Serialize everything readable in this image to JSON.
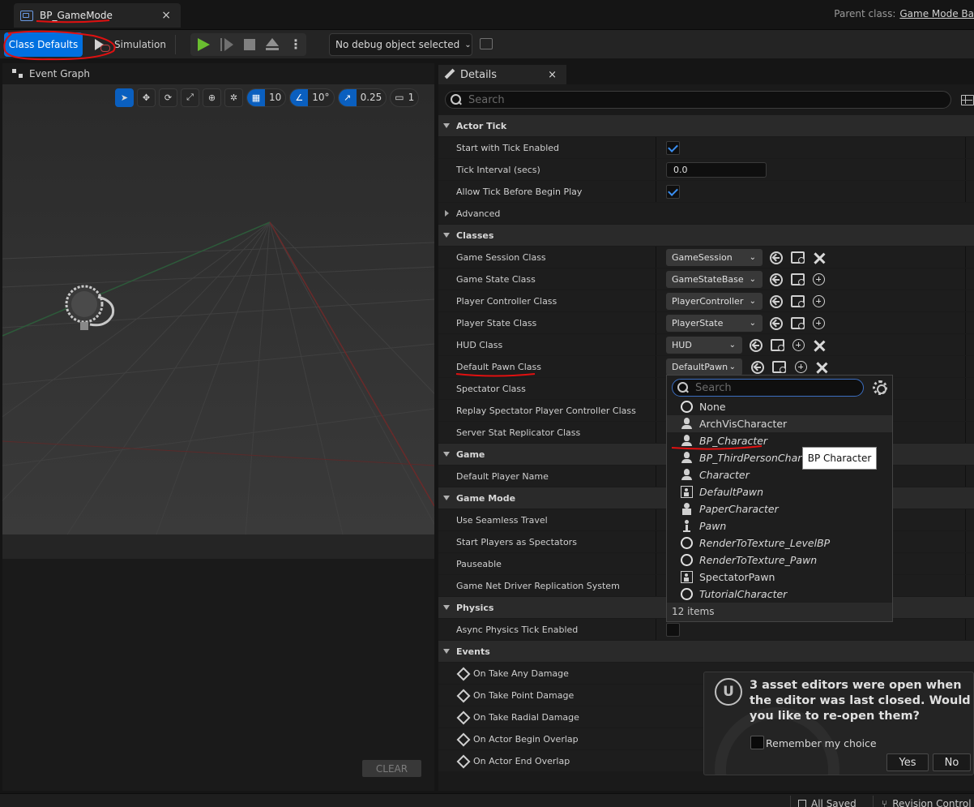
{
  "tab": {
    "title": "BP_GameMode",
    "close": "×"
  },
  "parent_class": {
    "label": "Parent class:",
    "value": "Game Mode Ba"
  },
  "toolbar": {
    "class_defaults": "Class Defaults",
    "simulation": "Simulation",
    "debug_select": "No debug object selected"
  },
  "event_graph": {
    "title": "Event Graph",
    "clear": "CLEAR"
  },
  "viewport_toolbar": {
    "grid": "10",
    "angle": "10°",
    "scale": "0.25",
    "camera": "1"
  },
  "details": {
    "title": "Details",
    "close": "×",
    "search_placeholder": "Search",
    "categories": {
      "actor_tick": "Actor Tick",
      "classes": "Classes",
      "game": "Game",
      "game_mode": "Game Mode",
      "physics": "Physics",
      "events": "Events"
    },
    "rows": {
      "start_tick": "Start with Tick Enabled",
      "tick_interval": "Tick Interval (secs)",
      "tick_interval_value": "0.0",
      "allow_tick": "Allow Tick Before Begin Play",
      "advanced": "Advanced",
      "game_session": "Game Session Class",
      "game_session_value": "GameSession",
      "game_state": "Game State Class",
      "game_state_value": "GameStateBase",
      "player_controller": "Player Controller Class",
      "player_controller_value": "PlayerController",
      "player_state": "Player State Class",
      "player_state_value": "PlayerState",
      "hud": "HUD Class",
      "hud_value": "HUD",
      "default_pawn": "Default Pawn Class",
      "default_pawn_value": "DefaultPawn",
      "spectator": "Spectator Class",
      "replay_spectator": "Replay Spectator Player Controller Class",
      "server_stat": "Server Stat Replicator Class",
      "default_player_name": "Default Player Name",
      "seamless_travel": "Use Seamless Travel",
      "start_spectators": "Start Players as Spectators",
      "pauseable": "Pauseable",
      "net_driver": "Game Net Driver Replication System",
      "async_physics": "Async Physics Tick Enabled",
      "ev_any_damage": "On Take Any Damage",
      "ev_point_damage": "On Take Point Damage",
      "ev_radial_damage": "On Take Radial Damage",
      "ev_begin_overlap": "On Actor Begin Overlap",
      "ev_end_overlap": "On Actor End Overlap"
    }
  },
  "dropdown": {
    "search_placeholder": "Search",
    "items": [
      "None",
      "ArchVisCharacter",
      "BP_Character",
      "BP_ThirdPersonChara",
      "Character",
      "DefaultPawn",
      "PaperCharacter",
      "Pawn",
      "RenderToTexture_LevelBP",
      "RenderToTexture_Pawn",
      "SpectatorPawn",
      "TutorialCharacter"
    ],
    "count": "12 items",
    "tooltip": "BP Character"
  },
  "notification": {
    "text": "3 asset editors were open when the editor was last closed. Would you like to re-open them?",
    "remember": "Remember my choice",
    "yes": "Yes",
    "no": "No"
  },
  "statusbar": {
    "saved": "All Saved",
    "revision": "Revision Control"
  },
  "colors": {
    "accent": "#0070e0",
    "play": "#6abe30",
    "annotation": "#e01010"
  }
}
